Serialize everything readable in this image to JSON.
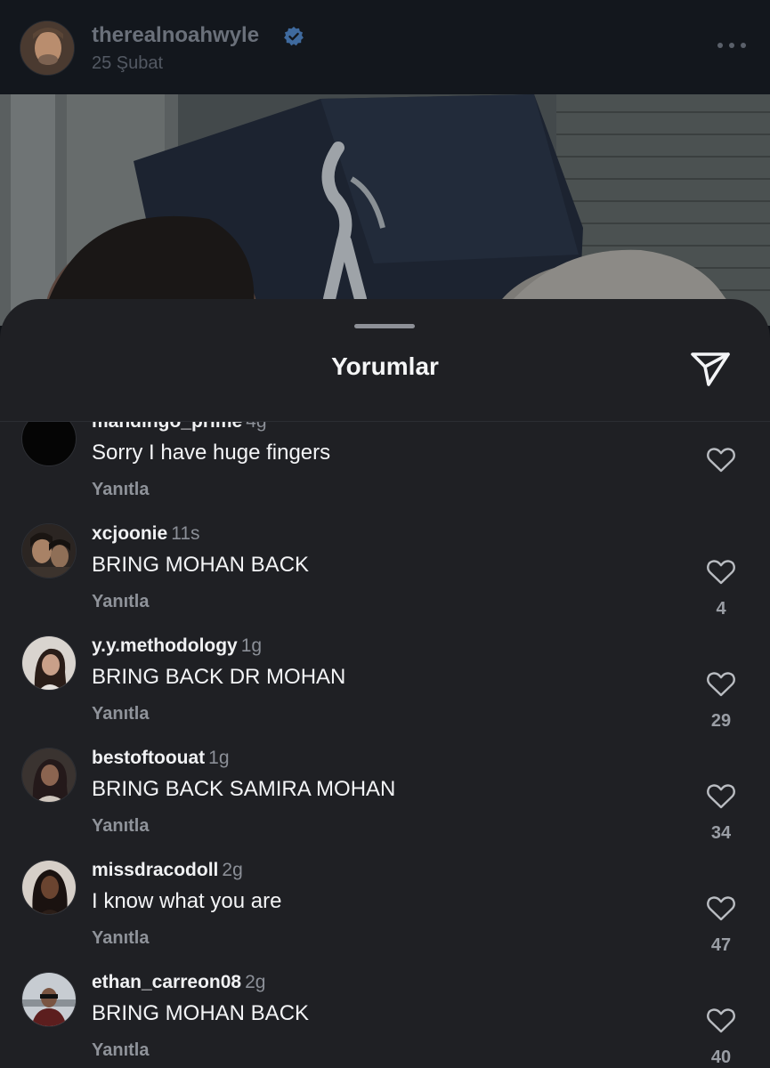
{
  "post": {
    "username": "therealnoahwyle",
    "date": "25 Şubat",
    "verified_icon": "verified-badge-icon",
    "more_icon": "more-horizontal-icon"
  },
  "sheet": {
    "title": "Yorumlar",
    "share_icon": "share-send-icon"
  },
  "comments": [
    {
      "username": "mandingo_prime",
      "time": "4g",
      "text": "Sorry I have huge fingers",
      "reply_label": "Yanıtla",
      "likes": ""
    },
    {
      "username": "xcjoonie",
      "time": "11s",
      "text": "BRING MOHAN BACK",
      "reply_label": "Yanıtla",
      "likes": "4"
    },
    {
      "username": "y.y.methodology",
      "time": "1g",
      "text": "BRING BACK DR MOHAN",
      "reply_label": "Yanıtla",
      "likes": "29"
    },
    {
      "username": "bestoftoouat",
      "time": "1g",
      "text": "BRING BACK SAMIRA MOHAN",
      "reply_label": "Yanıtla",
      "likes": "34"
    },
    {
      "username": "missdracodoll",
      "time": "2g",
      "text": "I know what you are",
      "reply_label": "Yanıtla",
      "likes": "47"
    },
    {
      "username": "ethan_carreon08",
      "time": "2g",
      "text": "BRING MOHAN BACK",
      "reply_label": "Yanıtla",
      "likes": "40"
    }
  ],
  "colors": {
    "sheet_background": "#1f2024",
    "header_background": "#13171d",
    "verified_blue": "#3897f0",
    "muted_text": "#8f939a"
  }
}
